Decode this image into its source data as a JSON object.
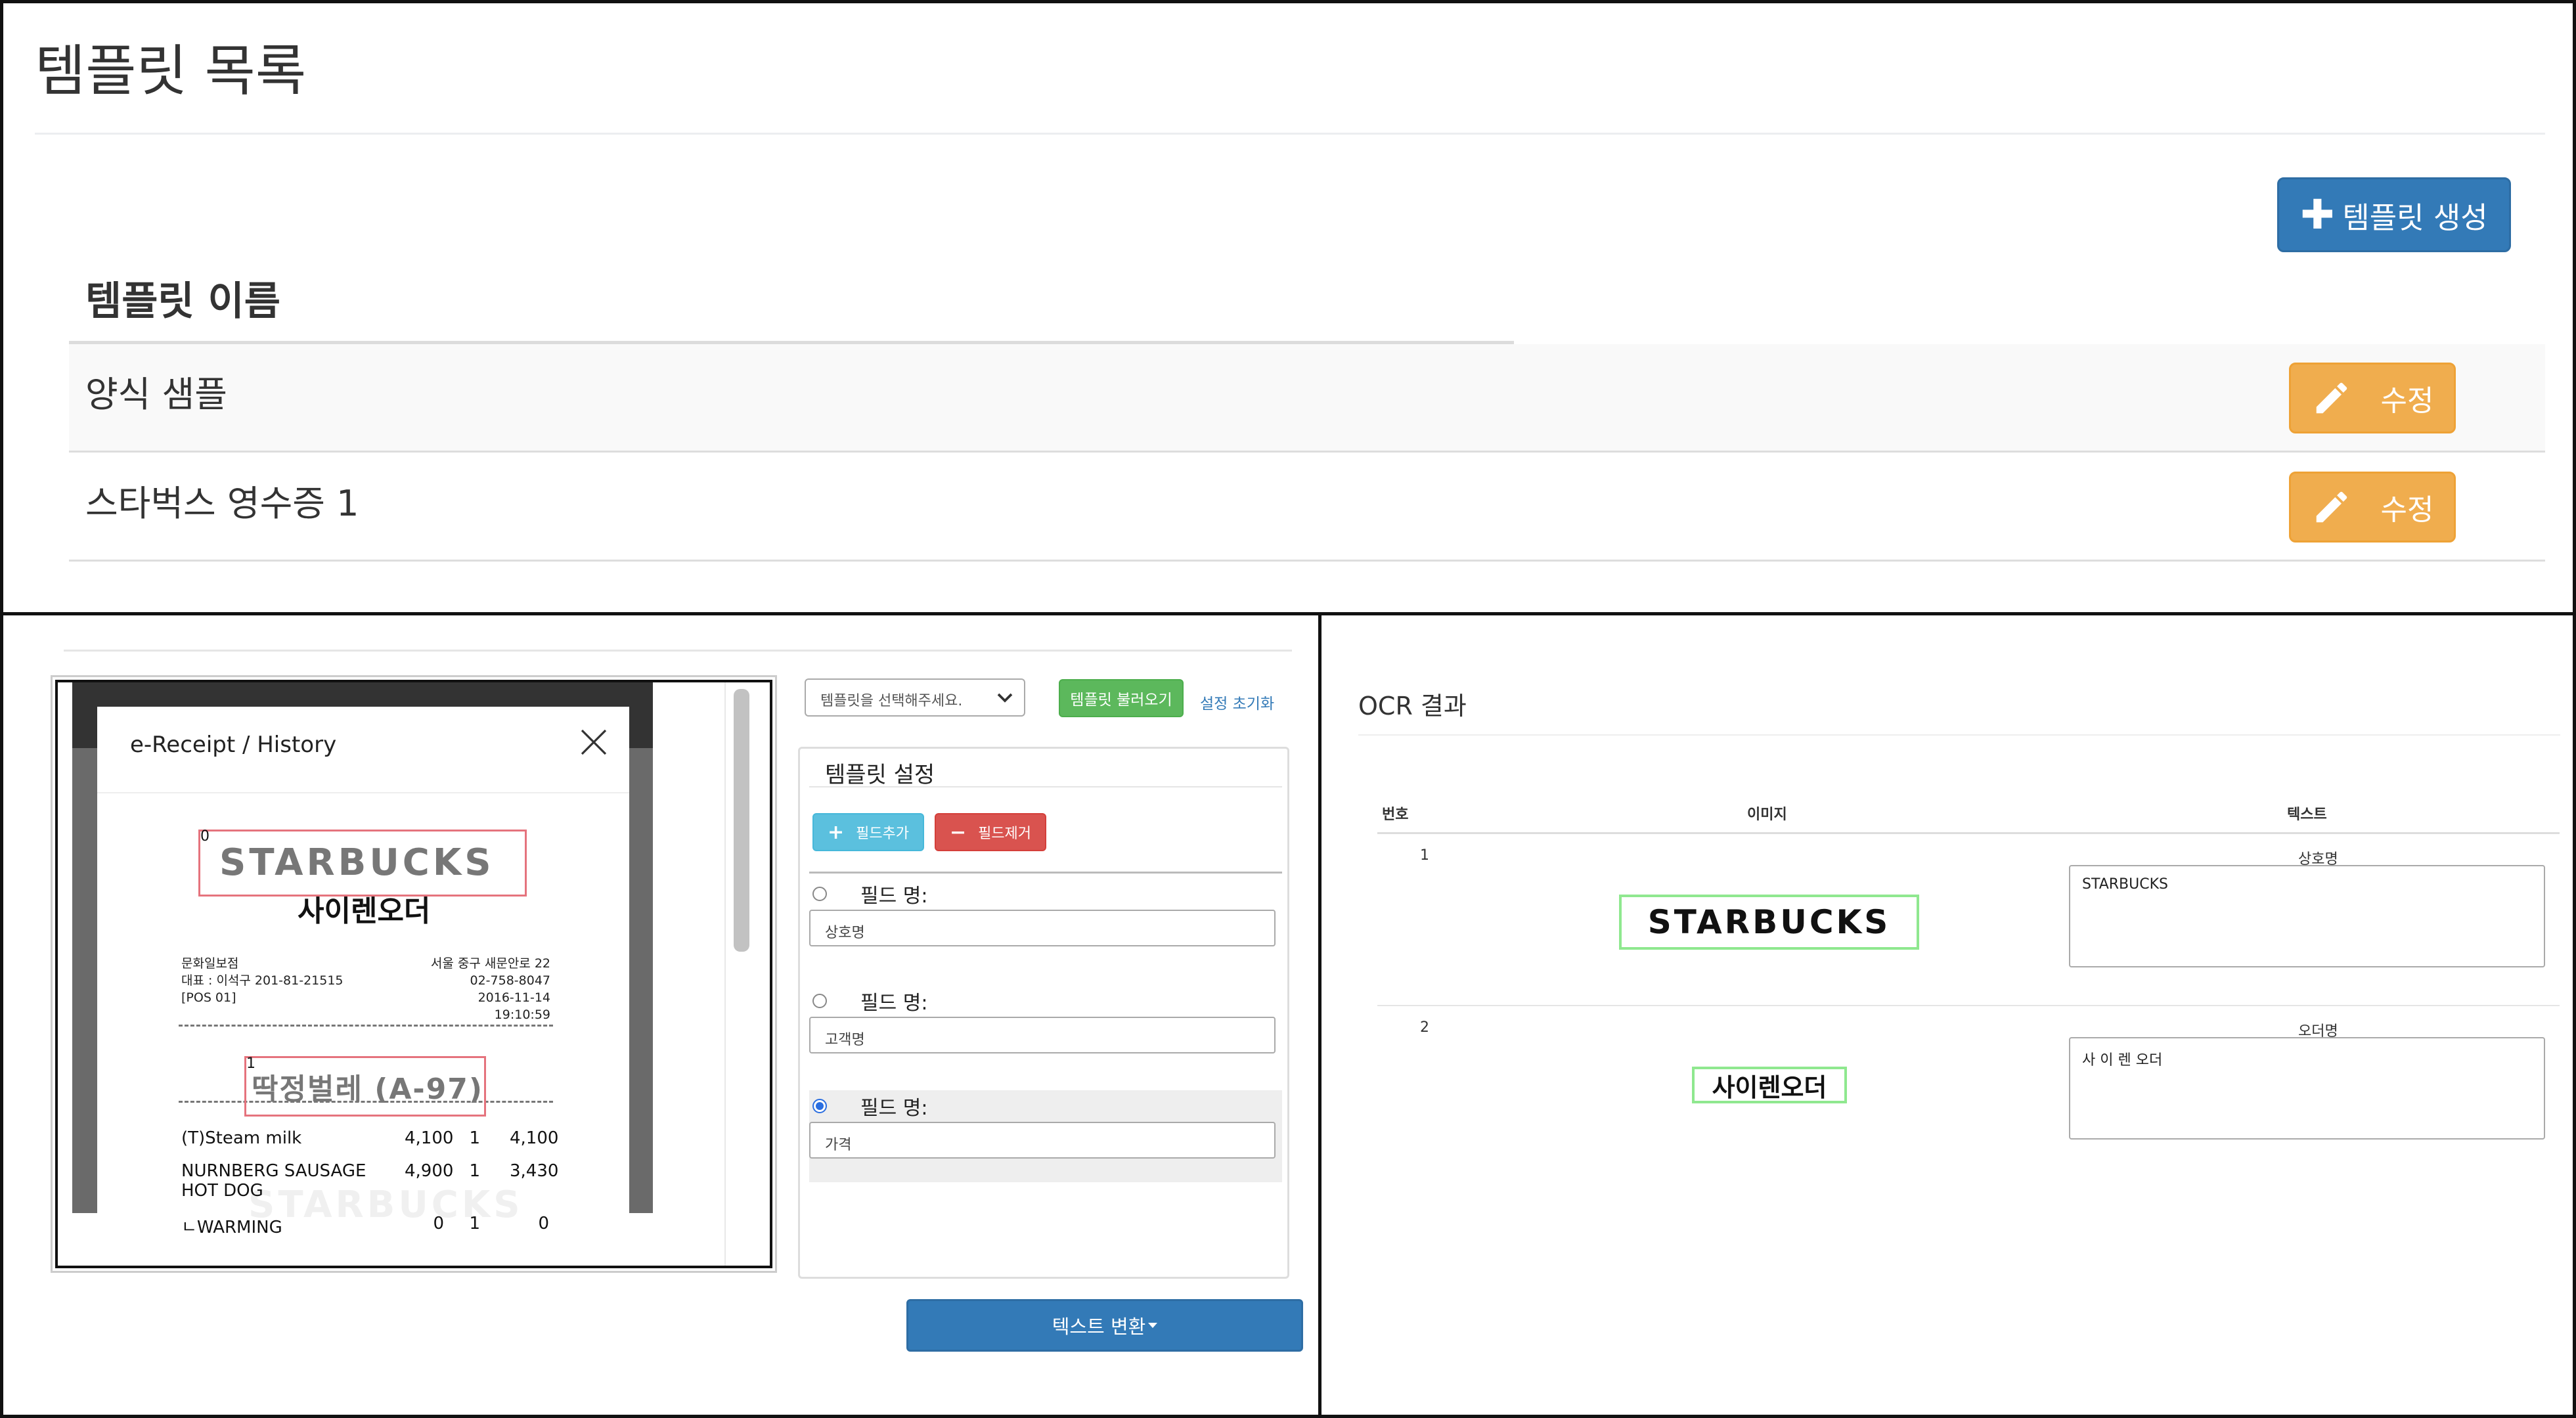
{
  "template_list": {
    "title": "템플릿 목록",
    "create_button": "템플릿 생성",
    "column_header": "템플릿 이름",
    "rows": [
      {
        "name": "양식 샘플",
        "edit_label": "수정"
      },
      {
        "name": "스타벅스 영수증 1",
        "edit_label": "수정"
      }
    ]
  },
  "editor": {
    "receipt": {
      "modal_title": "e-Receipt / History",
      "logo_text": "STARBUCKS",
      "order_name": "사이렌오더",
      "info_left": [
        "문화일보점",
        "대표 : 이석구 201-81-21515",
        "[POS 01]"
      ],
      "info_right": [
        "서울 중구 새문안로 22",
        "02-758-8047",
        "2016-11-14 19:10:59"
      ],
      "order_number": "딱정벌레 (A-97)",
      "items": [
        {
          "name": "(T)Steam milk",
          "price": "4,100",
          "qty": "1",
          "total": "4,100"
        },
        {
          "name": "NURNBERG SAUSAGE",
          "price": "4,900",
          "qty": "1",
          "total": "3,430"
        },
        {
          "name": "HOT DOG",
          "price": "",
          "qty": "",
          "total": ""
        },
        {
          "name": "ㄴWARMING",
          "price": "0",
          "qty": "1",
          "total": "0"
        }
      ],
      "box_labels": [
        "0",
        "1"
      ]
    },
    "select_placeholder": "템플릿을 선택해주세요.",
    "load_button": "템플릿 불러오기",
    "reset_link": "설정 초기화",
    "settings_title": "템플릿 설정",
    "add_field_button": "필드추가",
    "remove_field_button": "필드제거",
    "fields": [
      {
        "label": "필드 명:",
        "value": "상호명",
        "selected": false
      },
      {
        "label": "필드 명:",
        "value": "고객명",
        "selected": false
      },
      {
        "label": "필드 명:",
        "value": "가격",
        "selected": true
      }
    ],
    "convert_button": "텍스트 변환"
  },
  "ocr": {
    "title": "OCR 결과",
    "headers": {
      "no": "번호",
      "image": "이미지",
      "text": "텍스트"
    },
    "rows": [
      {
        "no": "1",
        "field": "상호명",
        "image_text": "STARBUCKS",
        "text": "STARBUCKS"
      },
      {
        "no": "2",
        "field": "오더명",
        "image_text": "사이렌오더",
        "text": "사 이 렌 오더"
      }
    ]
  },
  "colors": {
    "primary": "#337ab7",
    "warning": "#f0ad4e",
    "success": "#5cb85c",
    "info": "#5bc0de",
    "danger": "#d9534f",
    "box_red": "#e5737d",
    "box_green": "#8fe88f"
  }
}
